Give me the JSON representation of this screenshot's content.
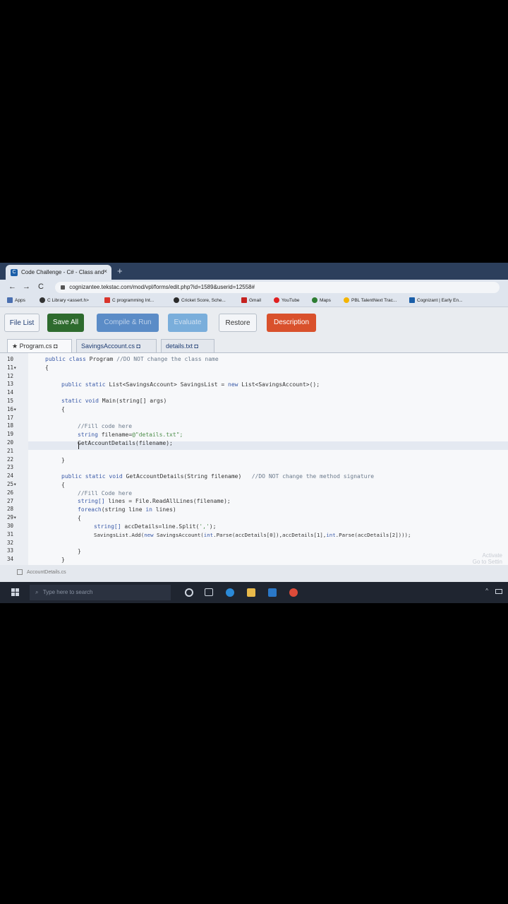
{
  "browser": {
    "tab_title": "Code Challenge - C# - Class and",
    "tab_close": "×",
    "new_tab": "+",
    "url": "cognizantee.tekstac.com/mod/vpl/forms/edit.php?id=1589&userid=12558#",
    "nav": {
      "back": "←",
      "forward": "→",
      "reload": "C"
    },
    "bookmarks": [
      {
        "label": "Apps",
        "color": "#4a6fb0"
      },
      {
        "label": "C Library <assert.h>",
        "color": "#333333"
      },
      {
        "label": "C programming Int...",
        "color": "#d9342b"
      },
      {
        "label": "Cricket Score, Sche...",
        "color": "#2b2b2b"
      },
      {
        "label": "Gmail",
        "color": "#c5221f"
      },
      {
        "label": "YouTube",
        "color": "#e02020"
      },
      {
        "label": "Maps",
        "color": "#2e7d32"
      },
      {
        "label": "PBL TalentNext Trac...",
        "color": "#f4b400"
      },
      {
        "label": "Cognizant | Early En...",
        "color": "#1a5ea8"
      }
    ]
  },
  "toolbar": {
    "file_list": "File List",
    "save_all": "Save All",
    "compile_run": "Compile & Run",
    "evaluate": "Evaluate",
    "restore": "Restore",
    "description": "Description"
  },
  "file_tabs": [
    {
      "label": "★ Program.cs ◘"
    },
    {
      "label": "SavingsAccount.cs ◘"
    },
    {
      "label": "details.txt ◘"
    }
  ],
  "code": {
    "line_numbers": [
      "10",
      "11",
      "12",
      "13",
      "14",
      "15",
      "16",
      "17",
      "18",
      "19",
      "20",
      "21",
      "22",
      "23",
      "24",
      "25",
      "26",
      "27",
      "28",
      "29",
      "30",
      "31",
      "32",
      "33",
      "34"
    ],
    "l10a": "public class ",
    "l10b": "Program",
    "l10c": " //DO NOT change the class name",
    "l11": "{",
    "l13a": "public static ",
    "l13b": "List<SavingsAccount> SavingsList = ",
    "l13c": "new ",
    "l13d": "List<SavingsAccount>();",
    "l15a": "static void ",
    "l15b": "Main(string[] args)",
    "l16": "{",
    "l18": "//Fill code here",
    "l19a": "string ",
    "l19b": "filename=",
    "l19c": "@\"details.txt\";",
    "l20": "GetAccountDetails(filename);",
    "l22": "}",
    "l24a": "public static void ",
    "l24b": "GetAccountDetails(String filename)",
    "l24c": "   //DO NOT change the method signature",
    "l25": "{",
    "l26": "//Fill Code here",
    "l27a": "string[] ",
    "l27b": "lines = File.ReadAllLines(filename);",
    "l28a": "foreach",
    "l28b": "(string ",
    "l28c": "line ",
    "l28d": "in ",
    "l28e": "lines)",
    "l29": "{",
    "l30a": "string[] ",
    "l30b": "accDetails=line.Split(",
    "l30c": "','",
    "l30d": ");",
    "l31a": "SavingsList.Add(",
    "l31b": "new ",
    "l31c": "SavingsAccount(",
    "l31d": "int",
    "l31e": ".Parse(accDetails[0]),accDetails[1],",
    "l31f": "int",
    "l31g": ".Parse(accDetails[2])));",
    "l33": "}",
    "l34": "}"
  },
  "statusbar": {
    "file": "AccountDetails.cs"
  },
  "watermark": {
    "line1": "Activate",
    "line2": "Go to Settin"
  },
  "taskbar": {
    "search_placeholder": "Type here to search"
  }
}
